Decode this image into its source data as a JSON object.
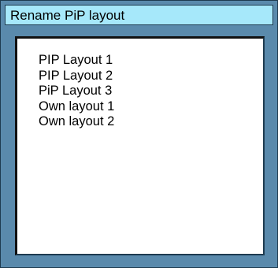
{
  "dialog": {
    "title": "Rename PiP layout",
    "items": [
      {
        "label": "PIP Layout 1"
      },
      {
        "label": "PIP Layout 2"
      },
      {
        "label": "PiP Layout 3"
      },
      {
        "label": "Own layout 1"
      },
      {
        "label": "Own layout 2"
      }
    ]
  },
  "colors": {
    "frame": "#5a8aac",
    "title_bar": "#a6e8fa",
    "list_background": "#ffffff",
    "border_dark": "#1e3b50"
  }
}
